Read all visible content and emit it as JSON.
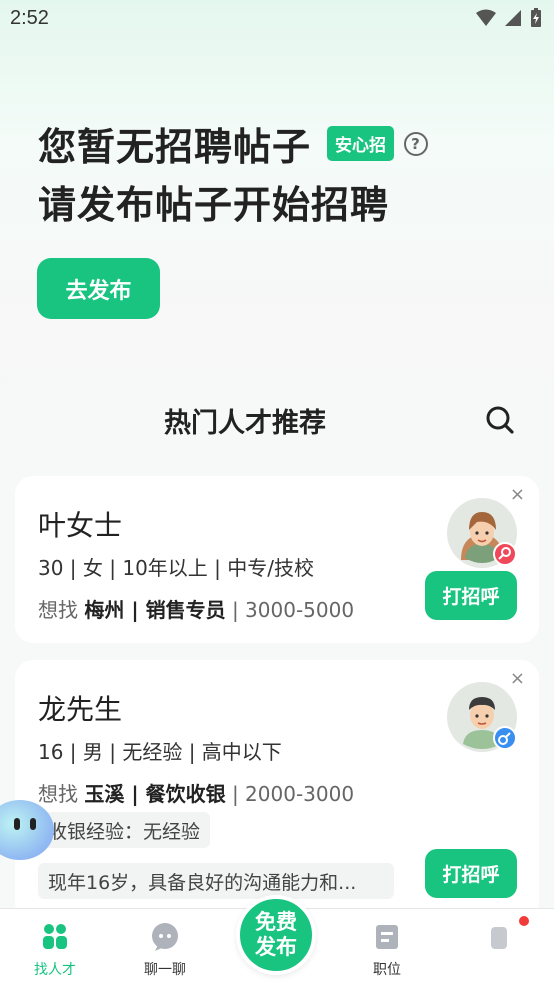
{
  "status_bar": {
    "time": "2:52"
  },
  "hero": {
    "line1": "您暂无招聘帖子",
    "badge": "安心招",
    "help": "?",
    "line2": "请发布帖子开始招聘",
    "publish_button": "去发布"
  },
  "recommend": {
    "title": "热门人才推荐",
    "cards": [
      {
        "name": "叶女士",
        "info": "30 | 女 | 10年以上 | 中专/技校",
        "want_prefix": "想找",
        "want_position": "梅州 | 销售专员",
        "want_salary": "| 3000-5000",
        "action": "打招呼",
        "close": "×"
      },
      {
        "name": "龙先生",
        "info": "16 | 男 | 无经验 | 高中以下",
        "want_prefix": "想找",
        "want_position": "玉溪 | 餐饮收银",
        "want_salary": "| 2000-3000",
        "tag": "收银经验：无经验",
        "intro": "现年16岁，具备良好的沟通能力和...",
        "action": "打招呼",
        "close": "×"
      }
    ]
  },
  "tabbar": {
    "items": [
      {
        "label": "找人才",
        "icon": "find-talent-icon",
        "active": true
      },
      {
        "label": "聊一聊",
        "icon": "chat-icon",
        "active": false
      },
      {
        "label": "职位",
        "icon": "position-icon",
        "active": false
      },
      {
        "label": "",
        "icon": "profile-icon",
        "active": false
      }
    ],
    "fab_line1": "免费",
    "fab_line2": "发布"
  },
  "colors": {
    "brand": "#19c380",
    "badge_red": "#f13a3a",
    "female": "#f0485b",
    "male": "#3a8ef0"
  }
}
